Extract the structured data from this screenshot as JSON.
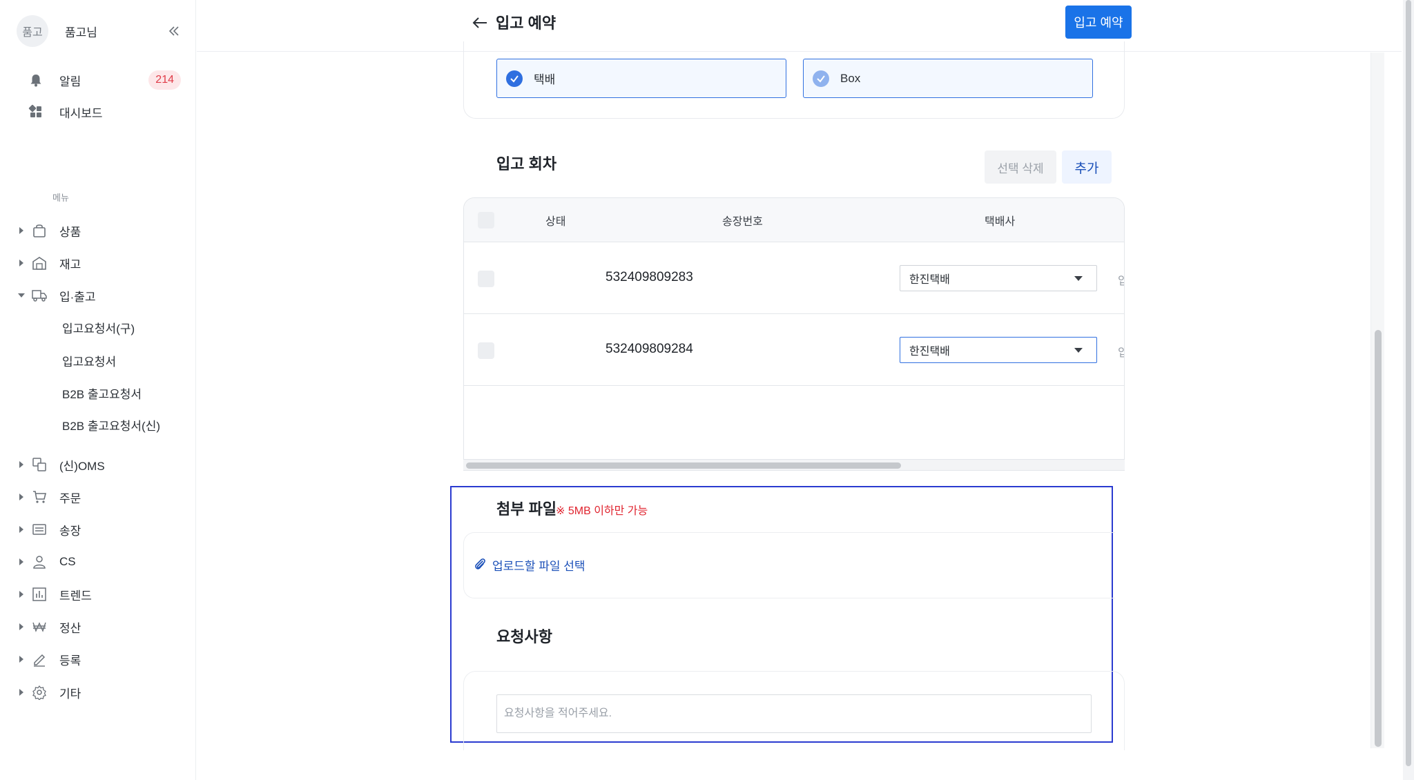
{
  "sidebar": {
    "avatar_text": "품고",
    "profile_name": "품고님",
    "top_items": [
      {
        "label": "알림",
        "badge": "214"
      },
      {
        "label": "대시보드"
      }
    ],
    "menu_caption": "메뉴",
    "menu_items": [
      {
        "label": "상품"
      },
      {
        "label": "재고"
      },
      {
        "label": "입·출고"
      },
      {
        "label": "(신)OMS"
      },
      {
        "label": "주문"
      },
      {
        "label": "송장"
      },
      {
        "label": "CS"
      },
      {
        "label": "트렌드"
      },
      {
        "label": "정산"
      },
      {
        "label": "등록"
      },
      {
        "label": "기타"
      }
    ],
    "sub_items": [
      {
        "label": "입고요청서(구)"
      },
      {
        "label": "입고요청서"
      },
      {
        "label": "B2B 출고요청서"
      },
      {
        "label": "B2B 출고요청서(신)"
      }
    ]
  },
  "header": {
    "title": "입고 예약",
    "primary_button": "입고 예약"
  },
  "options": [
    {
      "label": "택배",
      "checked_color": "#2f6fe0"
    },
    {
      "label": "Box",
      "checked_color": "#8fb2ee"
    }
  ],
  "rounds": {
    "title": "입고 회차",
    "delete_button": "선택 삭제",
    "add_button": "추가",
    "columns": [
      "상태",
      "송장번호",
      "택배사"
    ],
    "rows": [
      {
        "invoice": "532409809283",
        "carrier": "한진택배",
        "cut_text": "입"
      },
      {
        "invoice": "532409809284",
        "carrier": "한진택배",
        "cut_text": "입"
      }
    ]
  },
  "attachment": {
    "title": "첨부 파일",
    "note": "※ 5MB 이하만 가능",
    "upload_link": "업로드할 파일 선택"
  },
  "request": {
    "title": "요청사항",
    "placeholder": "요청사항을 적어주세요."
  },
  "colors": {
    "accent": "#1a73e8",
    "badge_bg": "#fde7e9",
    "badge_text": "#e03c48",
    "focus_border": "#2a3ad0",
    "warning_text": "#e0242f"
  }
}
